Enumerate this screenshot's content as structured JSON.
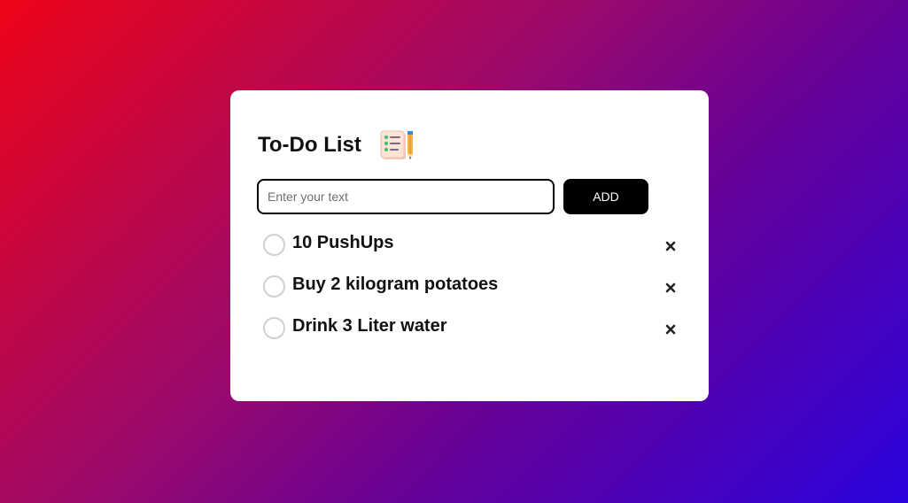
{
  "app": {
    "title": "To-Do List",
    "title_icon": "notepad-pencil-icon"
  },
  "input": {
    "value": "",
    "placeholder": "Enter your text"
  },
  "add_button": {
    "label": "ADD"
  },
  "tasks": [
    {
      "text": "10 PushUps",
      "checked": false,
      "delete_icon": "close-icon"
    },
    {
      "text": "Buy 2 kilogram potatoes",
      "checked": false,
      "delete_icon": "close-icon"
    },
    {
      "text": "Drink 3 Liter water",
      "checked": false,
      "delete_icon": "close-icon"
    }
  ],
  "colors": {
    "background_start": "#ee0418",
    "background_end": "#2a03dd",
    "card": "#ffffff",
    "button": "#000000",
    "circle_border": "#d0d0d0"
  }
}
